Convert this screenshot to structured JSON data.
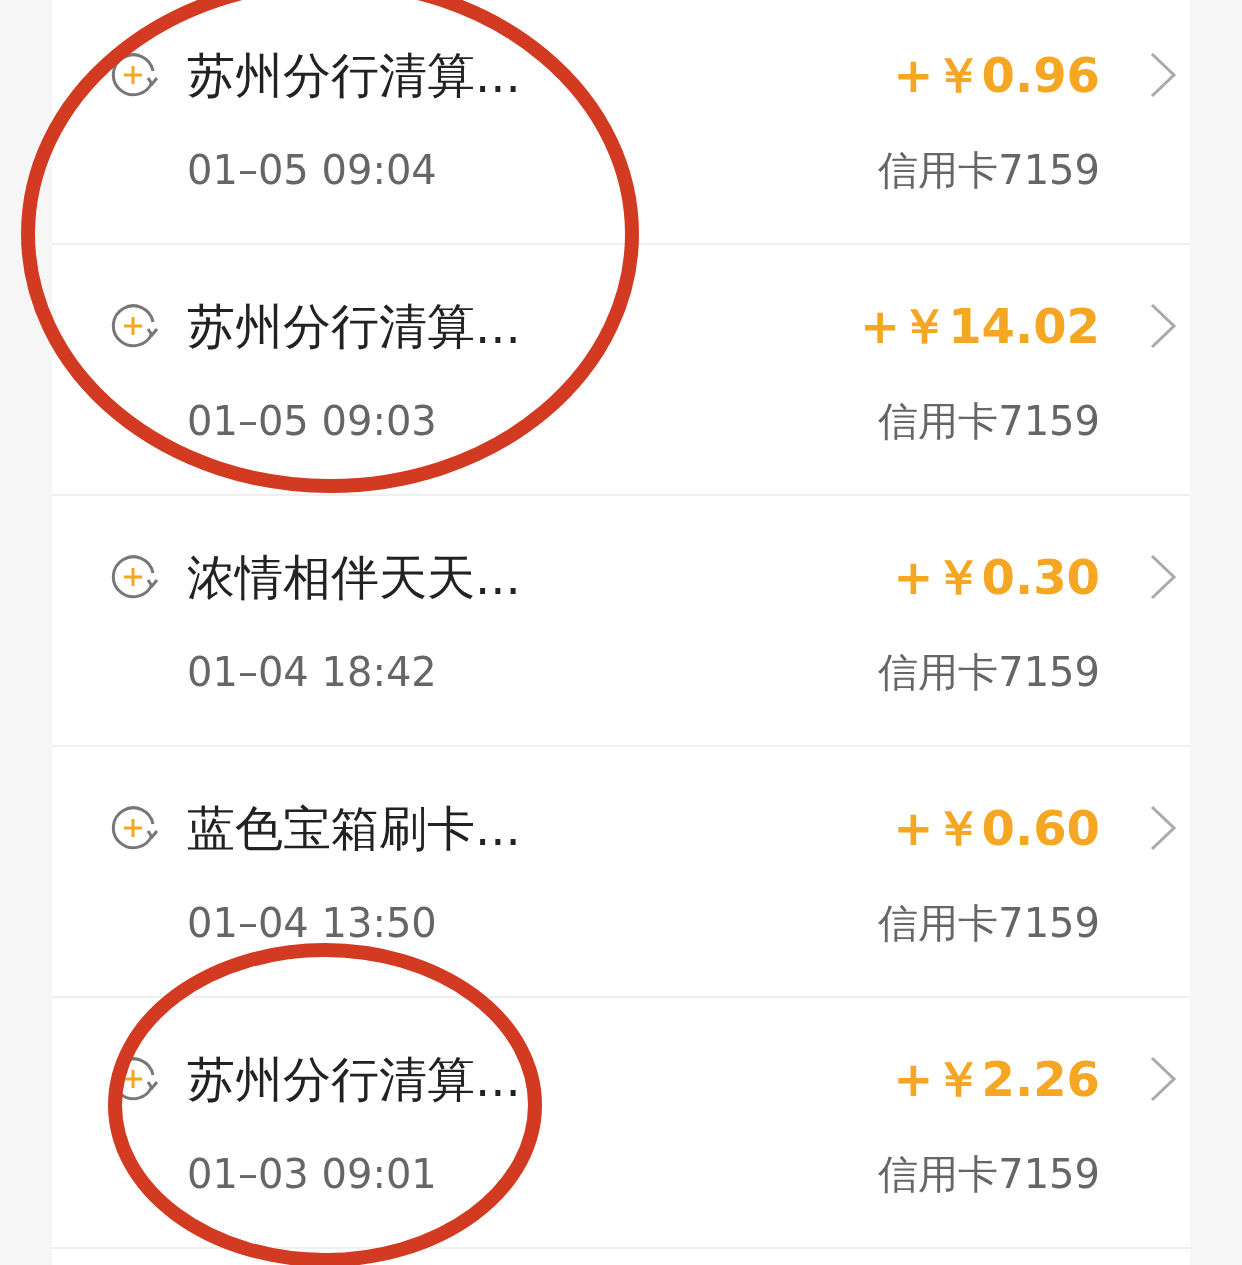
{
  "transactions": [
    {
      "title": "苏州分行清算...",
      "time": "01–05 09:04",
      "amount": "+￥0.96",
      "card": "信用卡7159"
    },
    {
      "title": "苏州分行清算...",
      "time": "01–05 09:03",
      "amount": "+￥14.02",
      "card": "信用卡7159"
    },
    {
      "title": "浓情相伴天天...",
      "time": "01–04 18:42",
      "amount": "+￥0.30",
      "card": "信用卡7159"
    },
    {
      "title": "蓝色宝箱刷卡...",
      "time": "01–04 13:50",
      "amount": "+￥0.60",
      "card": "信用卡7159"
    },
    {
      "title": "苏州分行清算...",
      "time": "01–03 09:01",
      "amount": "+￥2.26",
      "card": "信用卡7159"
    }
  ]
}
